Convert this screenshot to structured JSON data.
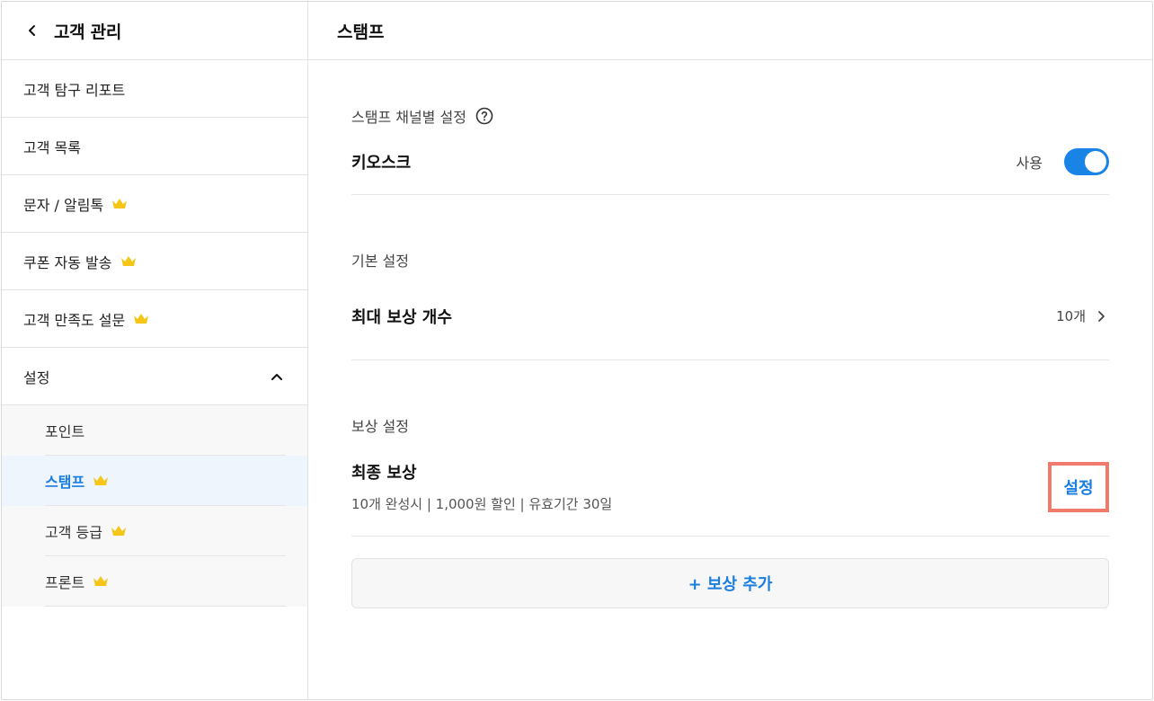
{
  "sidebar": {
    "header_title": "고객 관리",
    "items": [
      {
        "label": "고객 탐구 리포트"
      },
      {
        "label": "고객 목록"
      },
      {
        "label": "문자 / 알림톡"
      },
      {
        "label": "쿠폰 자동 발송"
      },
      {
        "label": "고객 만족도 설문"
      }
    ],
    "settings_label": "설정",
    "sub_items": [
      {
        "label": "포인트"
      },
      {
        "label": "스탬프"
      },
      {
        "label": "고객 등급"
      },
      {
        "label": "프론트"
      }
    ]
  },
  "main": {
    "title": "스탬프",
    "channel_section_label": "스탬프 채널별 설정",
    "kiosk_label": "키오스크",
    "kiosk_toggle_label": "사용",
    "basic_section_label": "기본 설정",
    "max_reward_label": "최대 보상 개수",
    "max_reward_value": "10개",
    "reward_section_label": "보상 설정",
    "final_reward_title": "최종 보상",
    "final_reward_desc": "10개 완성시  |  1,000원 할인  |  유효기간 30일",
    "settings_button_label": "설정",
    "add_reward_label": "+ 보상 추가"
  },
  "colors": {
    "accent": "#1a7ee0",
    "toggle_on": "#1a84e6",
    "crown": "#f5c518",
    "highlight_box": "#ef7b6c"
  },
  "icons": {
    "back": "chevron-left-icon",
    "crown": "crown-icon",
    "collapse": "chevron-up-icon",
    "help": "question-circle-icon",
    "next": "chevron-right-icon"
  }
}
